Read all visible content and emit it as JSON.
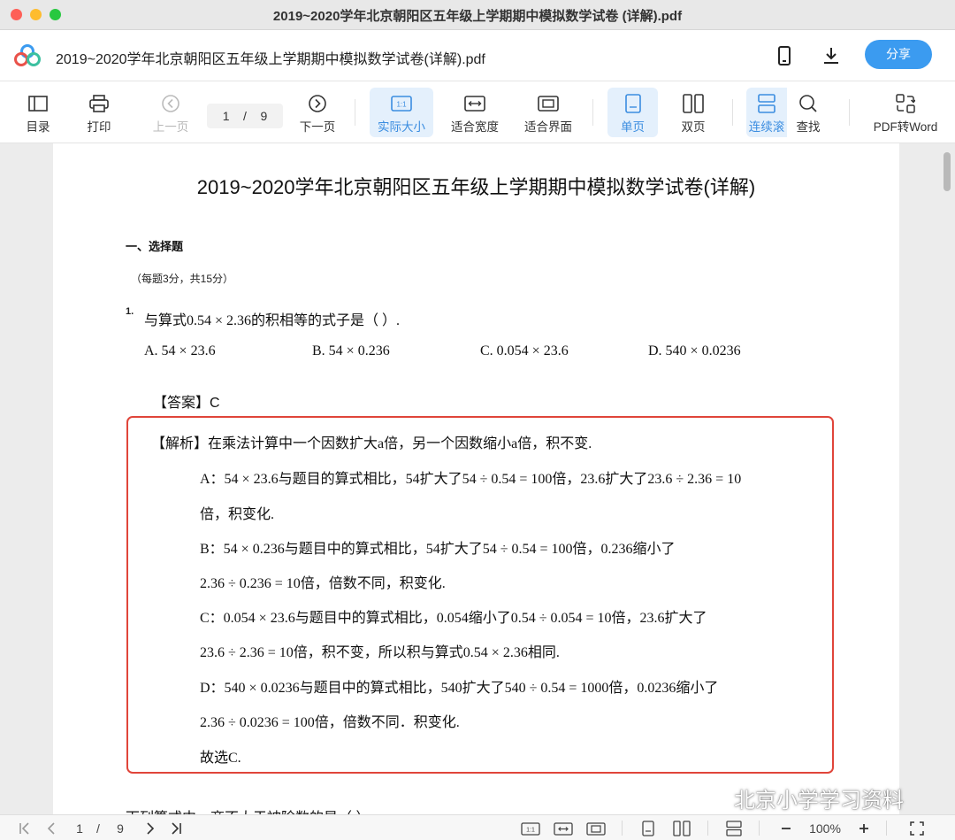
{
  "window": {
    "title": "2019~2020学年北京朝阳区五年级上学期期中模拟数学试卷 (详解).pdf"
  },
  "header": {
    "doc_title": "2019~2020学年北京朝阳区五年级上学期期中模拟数学试卷(详解).pdf",
    "share_label": "分享"
  },
  "toolbar": {
    "toc": "目录",
    "print": "打印",
    "prev": "上一页",
    "page_current": "1",
    "page_sep": "/",
    "page_total": "9",
    "next": "下一页",
    "actual_size": "实际大小",
    "fit_width": "适合宽度",
    "fit_page": "适合界面",
    "single": "单页",
    "double": "双页",
    "continuous": "连续滚",
    "find": "查找",
    "pdf_to_word": "PDF转Word",
    "actual_size_icon_text": "1:1"
  },
  "document": {
    "title": "2019~2020学年北京朝阳区五年级上学期期中模拟数学试卷(详解)",
    "section": "一、选择题",
    "section_note": "（每题3分，共15分）",
    "q1_number": "1.",
    "q1_text": "与算式0.54 × 2.36的积相等的式子是（   ）.",
    "options": [
      "A. 54 × 23.6",
      "B. 54 × 0.236",
      "C. 0.054 × 23.6",
      "D. 540 × 0.0236"
    ],
    "answer": "【答案】C",
    "analysis": [
      "【解析】在乘法计算中一个因数扩大a倍，另一个因数缩小a倍，积不变.",
      "A：54 × 23.6与题目的算式相比，54扩大了54 ÷ 0.54 = 100倍，23.6扩大了23.6 ÷ 2.36 = 10",
      "倍，积变化.",
      "B：54 × 0.236与题目中的算式相比，54扩大了54 ÷ 0.54 = 100倍，0.236缩小了",
      "2.36 ÷ 0.236 = 10倍，倍数不同，积变化.",
      "C：0.054 × 23.6与题目中的算式相比，0.054缩小了0.54 ÷ 0.054 = 10倍，23.6扩大了",
      "23.6 ÷ 2.36 = 10倍，积不变，所以积与算式0.54 × 2.36相同.",
      "D：540 × 0.0236与题目中的算式相比，540扩大了540 ÷ 0.54 = 1000倍，0.0236缩小了",
      "2.36 ÷ 0.0236 = 100倍，倍数不同．积变化.",
      "故选C."
    ],
    "q2_partial": "下列算式中，商不大于被除数的是（   ）"
  },
  "bottombar": {
    "page_current": "1",
    "page_sep": "/",
    "page_total": "9",
    "zoom": "100%",
    "actual_size_icon_text": "1:1"
  },
  "watermark": {
    "text": "北京小学学习资料"
  },
  "colors": {
    "accent": "#3b9bf0",
    "highlight_box": "#e0453a",
    "active_bg": "#e4f0fc"
  }
}
